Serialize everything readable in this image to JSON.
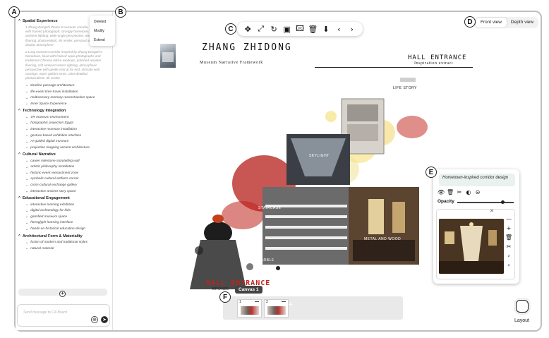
{
  "markers": {
    "a": "A",
    "b": "B",
    "c": "C",
    "d": "D",
    "e": "E",
    "f": "F"
  },
  "sidebar": {
    "sections": [
      {
        "title": "Spatial Experience",
        "prompts": [
          "1.Zhang Dongzhi theme 8 museum corridor, decorated with framed photograph, strongly hometown, warm ambient lighting, wide-angle perspective, wooden flooring, photorealistic, 8k render, personal artifact display atmosphere",
          "2.Long museum corridor inspired by Zhang Dongzhi's hometown, lined with framed sepia photographs and traditional Chinese lattice windows, polished wooden flooring, soft ambient lantern lighting, atmospheric perspective with gentle mist at far end, intricate wall carvings, warm golden tones, ultra-detailed, photorealistic, 8k render"
        ],
        "items": [
          "timeline passage architecture",
          "life-event time-travel installation",
          "multisensory memory reconstruction space",
          "Inner Space Experience"
        ]
      },
      {
        "title": "Technology Integration",
        "items": [
          "VR museum environment",
          "holographic projection Egypt",
          "interactive museum installation",
          "gesture-based exhibition interface",
          "AI-guided digital museum",
          "projection mapping ancient architecture"
        ]
      },
      {
        "title": "Cultural Narrative",
        "items": [
          "career milestone storytelling wall",
          "artistic philosophy installation",
          "historic event reenactment zone",
          "symbolic cultural artifacts corner",
          "cross-cultural exchange gallery",
          "interactive ancient story space"
        ]
      },
      {
        "title": "Educational Engagement",
        "items": [
          "interactive learning exhibition",
          "digital archaeology for kids",
          "gamified museum space",
          "hieroglyph learning interface",
          "hands-on historical education design"
        ]
      },
      {
        "title": "Architectural Form & Materiality",
        "items": [
          "fusion of modern and traditional styles",
          "natural material"
        ]
      }
    ],
    "message_placeholder": "Send message to CA Board"
  },
  "context_menu": [
    "Deleted",
    "Modify",
    "Extend"
  ],
  "toolbar": {
    "icons": [
      "move-icon",
      "fit-icon",
      "rotate-icon",
      "frame-icon",
      "add-image-icon",
      "trash-icon",
      "download-icon",
      "prev-icon",
      "next-icon"
    ],
    "glyphs": [
      "✥",
      "⤢",
      "↻",
      "▣",
      "🖾",
      "🗑",
      "⬇",
      "‹",
      "›"
    ]
  },
  "view_toggle": {
    "front": "Front view",
    "depth": "Depth view",
    "active": "front"
  },
  "page": {
    "title": "ZHANG ZHIDONG",
    "subtitle": "Museum Narrative Framework",
    "hall_title": "HALL ENTRANCE",
    "hall_subtitle": "Inspiration extract",
    "collage_labels": {
      "life_story": "LIFE STORY",
      "skylight": "SKYLIGHT",
      "staircase": "STAIRCASE",
      "metal_wood": "METAL AND WOOD",
      "marble": "MARBLE",
      "overlay_title": "HALL ENTRANCE",
      "bronze": "BRONZE"
    }
  },
  "panel_e": {
    "description": "Hometown-inspired corridor design",
    "opacity_label": "Opacity",
    "opacity_value": 0.8,
    "icon_row": [
      "eye-icon",
      "trash-icon",
      "scissors-icon",
      "color-icon",
      "link-icon"
    ],
    "side_tools": [
      "minus-icon",
      "plus-icon",
      "trash-icon",
      "scissors-icon",
      "chevron-right-icon",
      "chevron-left-icon"
    ]
  },
  "canvas_strip": {
    "tooltip": "Canvas 1",
    "canvases": [
      {
        "num": "1"
      },
      {
        "num": "2"
      }
    ],
    "add_label": "+"
  },
  "layout": {
    "label": "Layout"
  },
  "colors": {
    "accent_green": "#e9f2ee",
    "collage_red": "#c0221b",
    "gold": "#f2d25a"
  }
}
